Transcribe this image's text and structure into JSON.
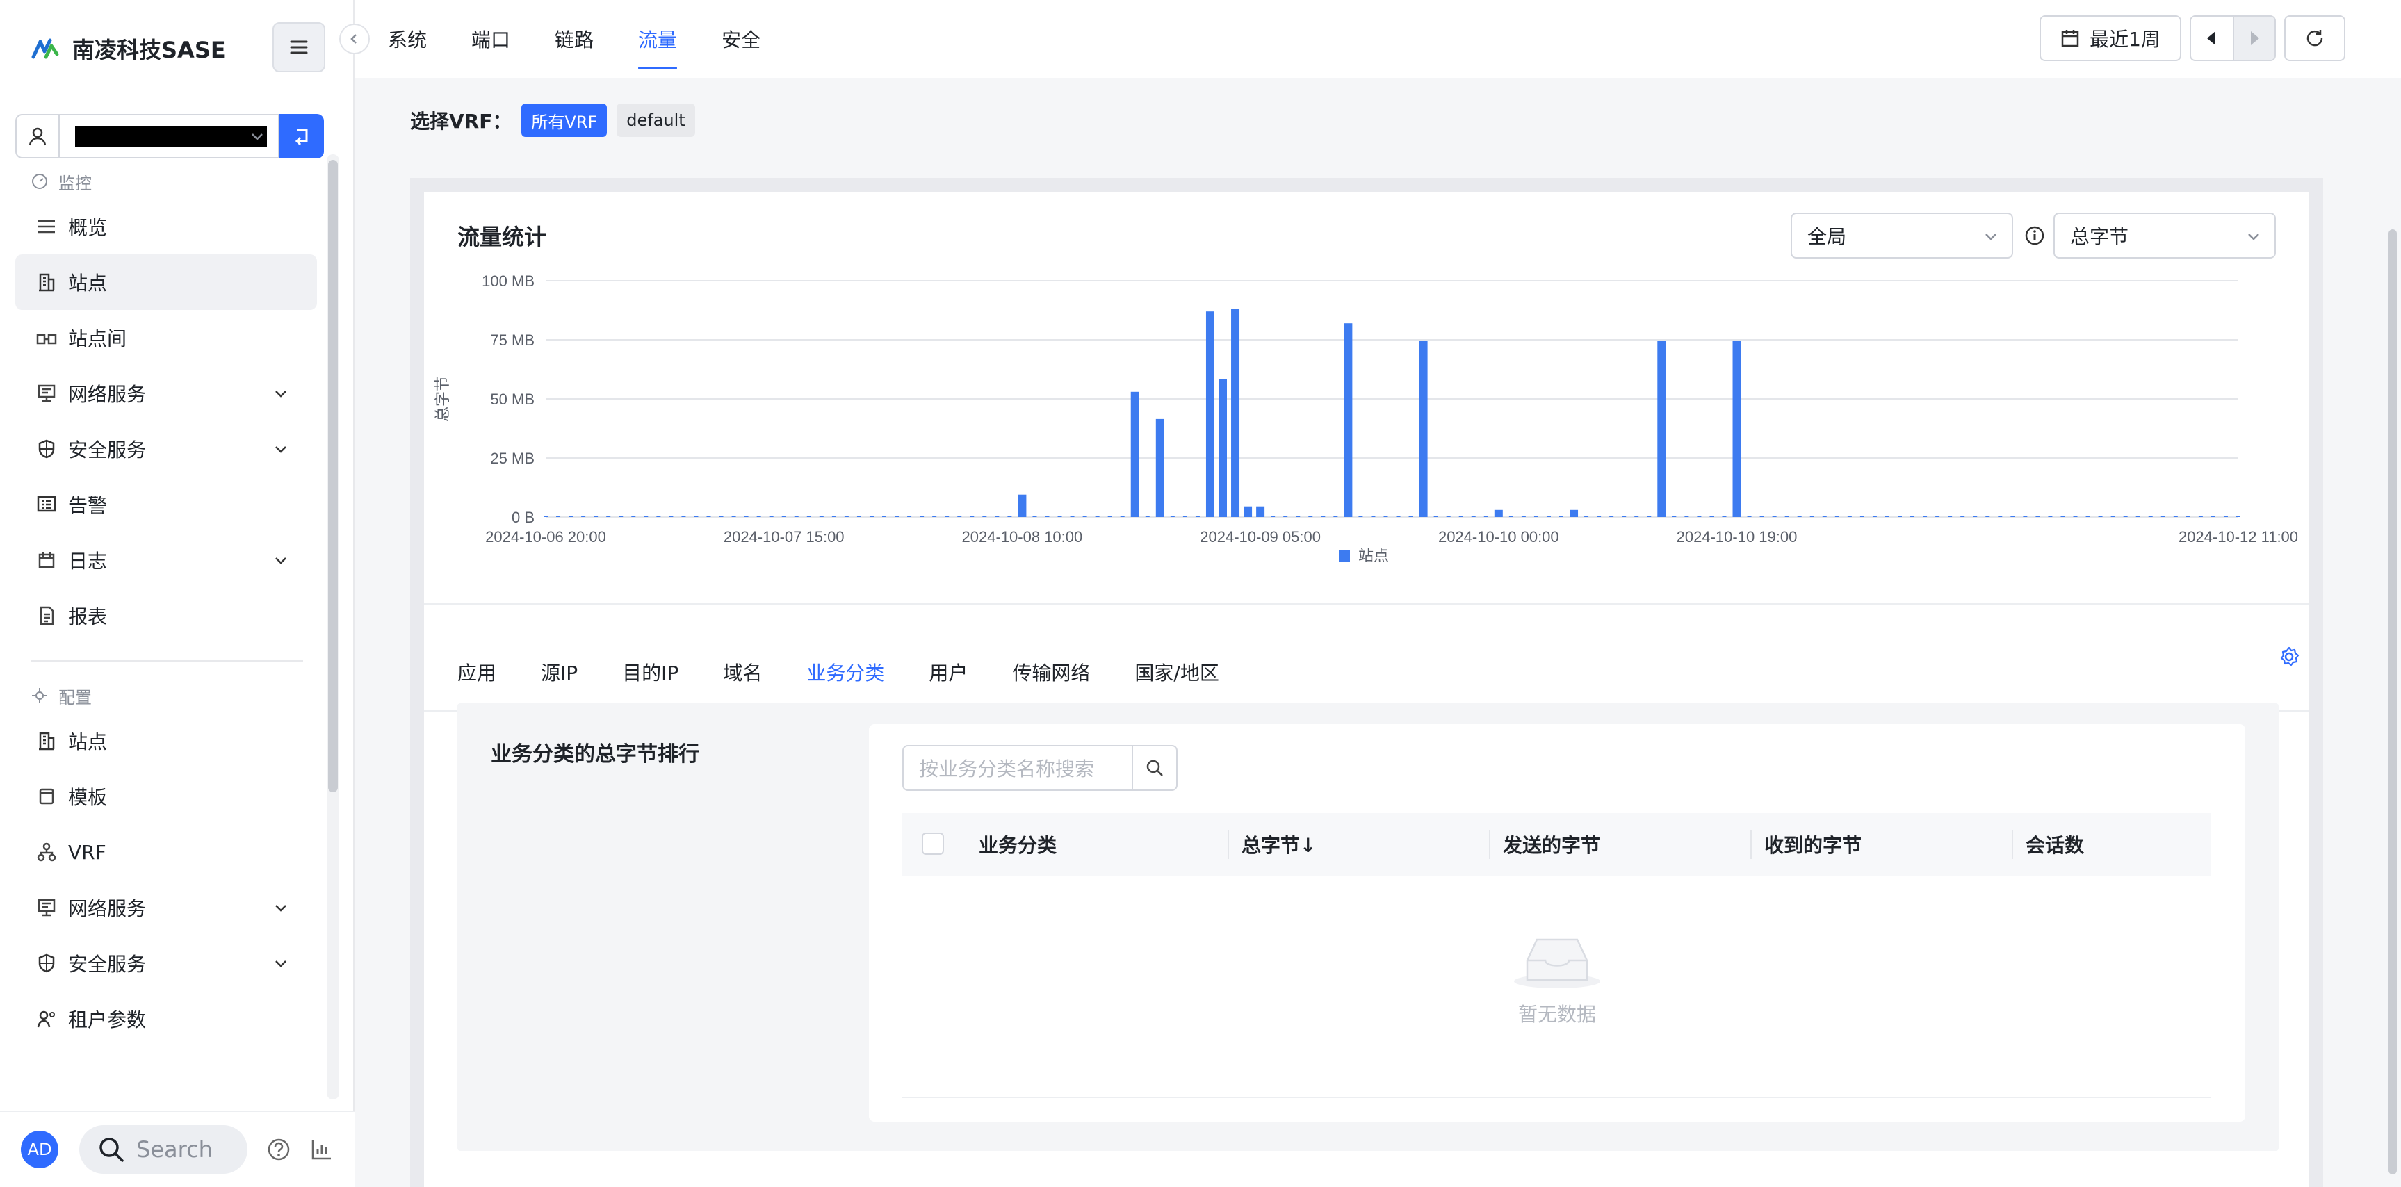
{
  "brand": {
    "name": "南凌科技SASE"
  },
  "sidebar": {
    "monitor_section": "监控",
    "monitor_items": [
      {
        "label": "概览",
        "icon": "overview-icon"
      },
      {
        "label": "站点",
        "icon": "building-icon",
        "active": true
      },
      {
        "label": "站点间",
        "icon": "site-link-icon"
      },
      {
        "label": "网络服务",
        "icon": "network-service-icon",
        "expandable": true
      },
      {
        "label": "安全服务",
        "icon": "shield-icon",
        "expandable": true
      },
      {
        "label": "告警",
        "icon": "alert-icon"
      },
      {
        "label": "日志",
        "icon": "calendar-icon",
        "expandable": true
      },
      {
        "label": "报表",
        "icon": "report-icon"
      }
    ],
    "config_section": "配置",
    "config_items": [
      {
        "label": "站点",
        "icon": "building-icon"
      },
      {
        "label": "模板",
        "icon": "template-icon"
      },
      {
        "label": "VRF",
        "icon": "vrf-icon"
      },
      {
        "label": "网络服务",
        "icon": "network-service-icon",
        "expandable": true
      },
      {
        "label": "安全服务",
        "icon": "shield-icon",
        "expandable": true
      },
      {
        "label": "租户参数",
        "icon": "tenant-params-icon"
      }
    ],
    "footer": {
      "avatar": "AD",
      "search_placeholder": "Search"
    }
  },
  "topbar": {
    "tabs": [
      "系统",
      "端口",
      "链路",
      "流量",
      "安全"
    ],
    "active_tab": 3,
    "range_label": "最近1周"
  },
  "vrf": {
    "label": "选择VRF：",
    "options": [
      "所有VRF",
      "default"
    ],
    "selected": 0
  },
  "traffic": {
    "title": "流量统计",
    "scope_select": "全局",
    "metric_select": "总字节"
  },
  "chart_data": {
    "type": "bar",
    "title": "",
    "ylabel": "总字节",
    "xlabel": "",
    "ylim": [
      0,
      100
    ],
    "y_unit": "MB",
    "y_ticks": [
      "100 MB",
      "75 MB",
      "50 MB",
      "25 MB",
      "0 B"
    ],
    "x_ticks": [
      "2024-10-06 20:00",
      "2024-10-07 15:00",
      "2024-10-08 10:00",
      "2024-10-09 05:00",
      "2024-10-10 00:00",
      "2024-10-10 19:00",
      "2024-10-12 11:00"
    ],
    "series": [
      {
        "name": "站点",
        "color": "#3d7bf0",
        "x": [
          "2024-10-08 10:00",
          "2024-10-08 19:00",
          "2024-10-08 21:00",
          "2024-10-09 01:00",
          "2024-10-09 02:00",
          "2024-10-09 03:00",
          "2024-10-09 04:00",
          "2024-10-09 05:00",
          "2024-10-09 12:00",
          "2024-10-09 18:00",
          "2024-10-10 00:00",
          "2024-10-10 06:00",
          "2024-10-10 13:00",
          "2024-10-10 19:00"
        ],
        "values": [
          9.5,
          53,
          41.5,
          87,
          58.5,
          88,
          4.5,
          4.5,
          82,
          74.5,
          3,
          3,
          74.5,
          74.5
        ]
      }
    ],
    "legend": "bottom-center"
  },
  "sub_tabs": {
    "items": [
      "应用",
      "源IP",
      "目的IP",
      "域名",
      "业务分类",
      "用户",
      "传输网络",
      "国家/地区"
    ],
    "active": 4
  },
  "ranking": {
    "title": "业务分类的总字节排行",
    "search_placeholder": "按业务分类名称搜索",
    "columns": [
      "业务分类",
      "总字节↓",
      "发送的字节",
      "收到的字节",
      "会话数"
    ],
    "empty_text": "暂无数据"
  }
}
